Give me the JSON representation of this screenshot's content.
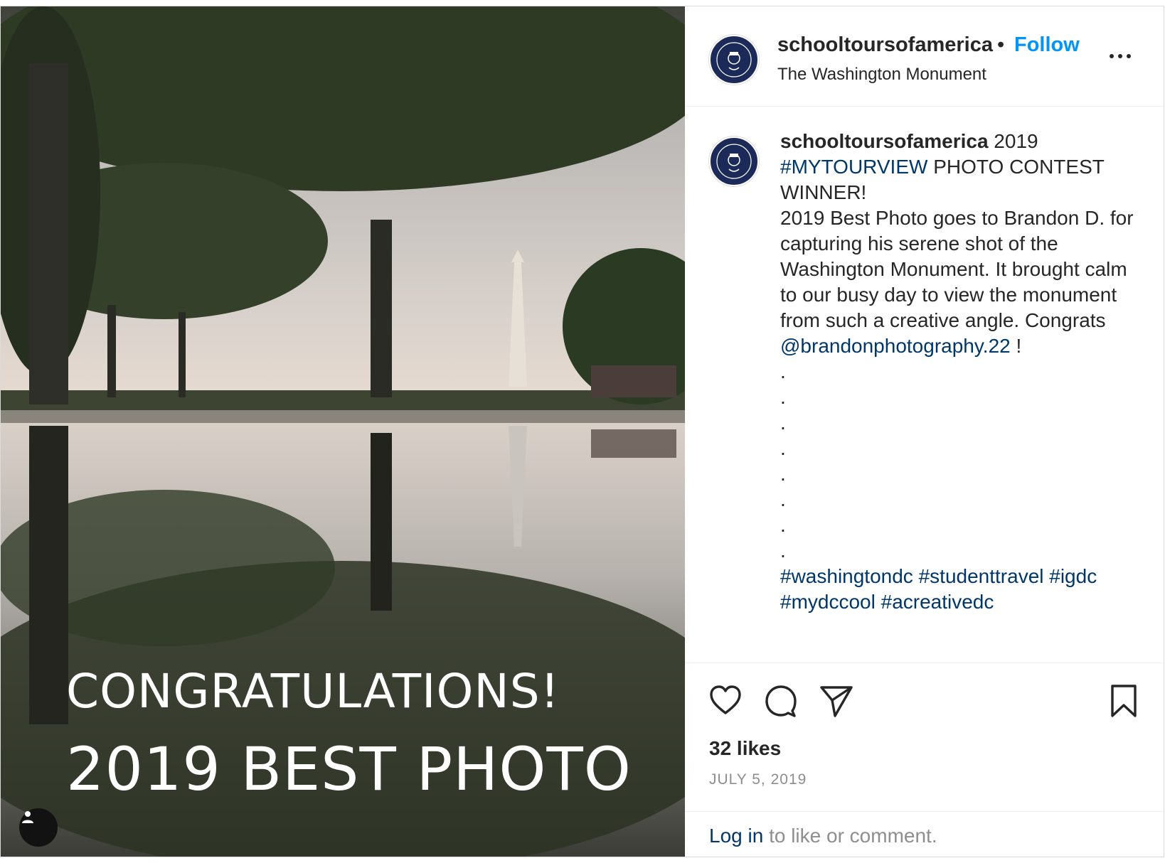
{
  "post": {
    "image": {
      "description_icon": "user-tag-icon",
      "overlay_line1": "CONGRATULATIONS!",
      "overlay_line2": "2019 BEST PHOTO"
    },
    "header": {
      "username": "schooltoursofamerica",
      "separator": "•",
      "follow_label": "Follow",
      "location": "The Washington Monument",
      "more_icon": "more-horizontal-icon",
      "avatar_icon": "school-tours-logo"
    },
    "caption": {
      "username": "schooltoursofamerica",
      "lead": " 2019 ",
      "tag_mytourview": "#MYTOURVIEW",
      "line1_rest": " PHOTO CONTEST WINNER!",
      "body": "2019 Best Photo goes to Brandon D. for capturing his serene shot of the Washington Monument. It brought calm to our busy day to view the monument from such a creative angle. Congrats ",
      "mention": "@brandonphotography.22",
      "after_mention": " !",
      "dots": ".\n.\n.\n.\n.\n.\n.\n.",
      "hashtags": [
        "#washingtondc",
        "#studenttravel",
        "#igdc",
        "#mydccool",
        "#acreativedc"
      ]
    },
    "actions": {
      "like_icon": "heart-icon",
      "comment_icon": "comment-icon",
      "share_icon": "paper-plane-icon",
      "save_icon": "bookmark-icon"
    },
    "likes_label": "32 likes",
    "date": "JULY 5, 2019",
    "login": {
      "link": "Log in",
      "rest": " to like or comment."
    }
  },
  "colors": {
    "follow_blue": "#0095f6",
    "link_navy": "#00376b",
    "muted_gray": "#8e8e8e",
    "avatar_navy": "#1c2a59"
  }
}
